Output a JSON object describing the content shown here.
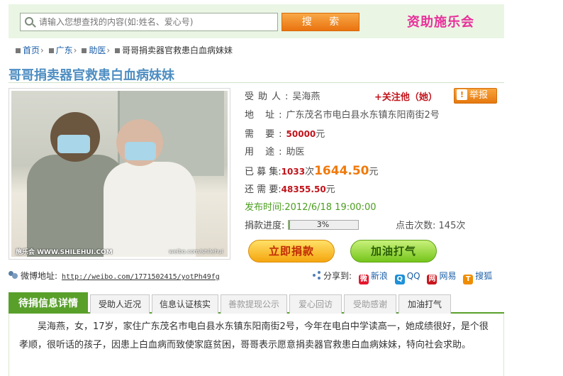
{
  "search": {
    "placeholder": "请输入您想查找的内容(如:姓名、爱心号)",
    "button_label": "搜 索"
  },
  "brand": {
    "text": "资助施乐会"
  },
  "breadcrumb": [
    "首页",
    "广东",
    "助医",
    "哥哥捐卖器官救患白血病妹妹"
  ],
  "page_title": "哥哥捐卖器官救患白血病妹妹",
  "photo": {
    "watermark_left": "施乐会 WWW.SHILEHUI.COM",
    "watermark_right": "weibo.com/shilehui"
  },
  "info": {
    "recipient_label": "受助人:",
    "recipient": "吴海燕",
    "address_label": "地 址:",
    "address": "广东茂名市电白县水东镇东阳南街2号",
    "need_label": "需 要:",
    "need_amount": "50000",
    "need_unit": "元",
    "use_label": "用 途:",
    "use": "助医",
    "raised_label": "已 募 集:",
    "raised_count": "1033",
    "raised_count_unit": "次",
    "raised_amount": "1644.50",
    "raised_unit": "元",
    "remaining_label": "还 需 要:",
    "remaining_amount": "48355.50",
    "remaining_unit": "元",
    "time_label": "发布时间:",
    "time": "2012/6/18 19:00:00",
    "progress_label": "捐款进度:",
    "progress_percent": 3,
    "progress_text": "3%",
    "clicks_label": "点击次数:",
    "clicks": "145次"
  },
  "follow_label": "关注他（她）",
  "report_label": "举报",
  "buttons": {
    "donate": "立即捐款",
    "cheer": "加油打气"
  },
  "weibo": {
    "label": "微博地址:",
    "url": "http://weibo.com/1771502415/yotPh49fg"
  },
  "share": {
    "label": "分享到:",
    "targets": [
      {
        "name": "新浪",
        "icon": "sina-weibo-icon",
        "color": "#e6162d"
      },
      {
        "name": "QQ",
        "icon": "qq-icon",
        "color": "#1e90d8"
      },
      {
        "name": "网易",
        "icon": "netease-icon",
        "color": "#c8161d"
      },
      {
        "name": "搜狐",
        "icon": "sohu-icon",
        "color": "#f08c00"
      }
    ]
  },
  "tabs": [
    "待捐信息详情",
    "受助人近况",
    "信息认证核实",
    "善款提现公示",
    "爱心回访",
    "受助感谢",
    "加油打气"
  ],
  "content_text": "吴海燕，女，17岁，家住广东茂名市电白县水东镇东阳南街2号，今年在电白中学读高一，她成绩很好，是个很孝顺，很听话的孩子，因患上白血病而致使家庭贫困，哥哥表示愿意捐卖器官救患白血病妹妹，特向社会求助。",
  "colors": {
    "accent_green": "#59a02b",
    "accent_orange": "#f07a0b",
    "brand_pink": "#e8309a",
    "link_blue": "#1a5ea8"
  }
}
